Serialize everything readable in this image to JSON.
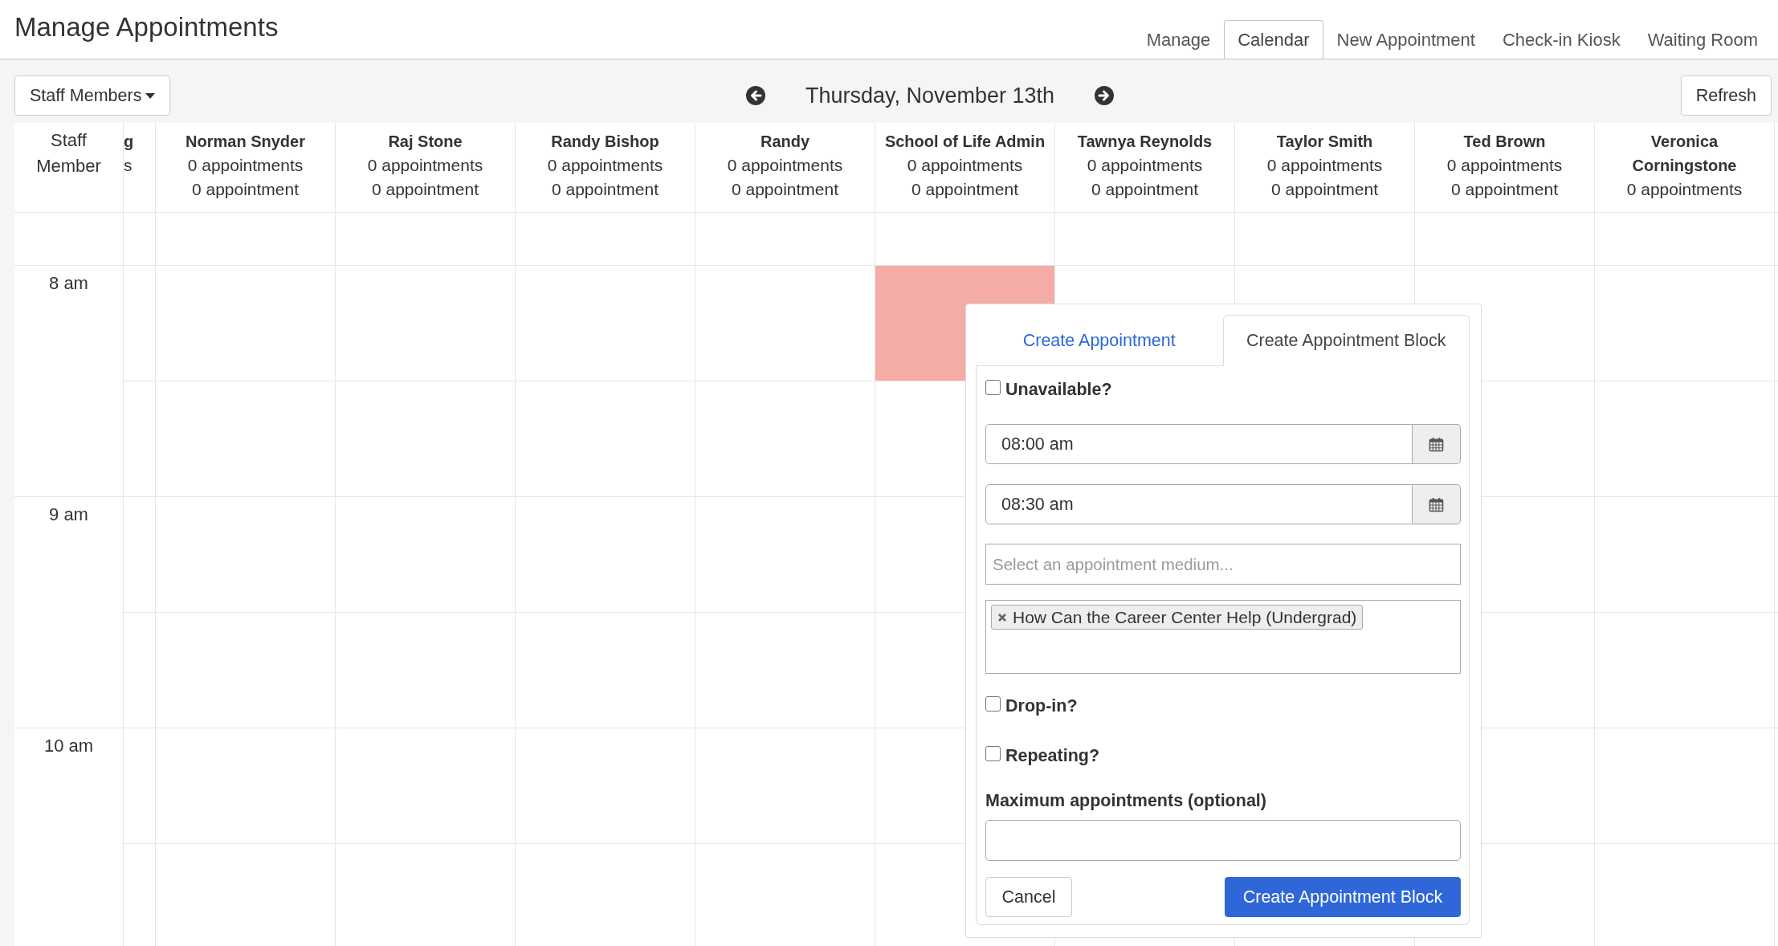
{
  "header": {
    "title": "Manage Appointments",
    "tabs": [
      {
        "label": "Manage",
        "selected": false
      },
      {
        "label": "Calendar",
        "selected": true
      },
      {
        "label": "New Appointment",
        "selected": false
      },
      {
        "label": "Check-in Kiosk",
        "selected": false
      },
      {
        "label": "Waiting Room",
        "selected": false
      }
    ]
  },
  "toolbar": {
    "staff_filter": "Staff Members",
    "date": "Thursday, November 13th",
    "refresh": "Refresh"
  },
  "calendar": {
    "corner_label": "Staff Member",
    "staff": [
      {
        "kind": "clipped",
        "name": "g",
        "lines": [
          "s"
        ],
        "selected": false
      },
      {
        "kind": "full",
        "name": "Norman Snyder",
        "lines": [
          "0 appointments",
          "0 appointment"
        ],
        "selected": false
      },
      {
        "kind": "full",
        "name": "Raj Stone",
        "lines": [
          "0 appointments",
          "0 appointment"
        ],
        "selected": false
      },
      {
        "kind": "full",
        "name": "Randy Bishop",
        "lines": [
          "0 appointments",
          "0 appointment"
        ],
        "selected": false
      },
      {
        "kind": "full",
        "name": "Randy",
        "lines": [
          "0 appointments",
          "0 appointment"
        ],
        "selected": false
      },
      {
        "kind": "full",
        "name": "School of Life Admin",
        "lines": [
          "0 appointments",
          "0 appointment"
        ],
        "selected": true
      },
      {
        "kind": "full",
        "name": "Tawnya Reynolds",
        "lines": [
          "0 appointments",
          "0 appointment"
        ],
        "selected": false
      },
      {
        "kind": "full",
        "name": "Taylor Smith",
        "lines": [
          "0 appointments",
          "0 appointment"
        ],
        "selected": false
      },
      {
        "kind": "full",
        "name": "Ted Brown",
        "lines": [
          "0 appointments",
          "0 appointment"
        ],
        "selected": false
      },
      {
        "kind": "full",
        "name": "Veronica Corningstone",
        "lines": [
          "0 appointments"
        ],
        "selected": false
      }
    ],
    "slots": [
      {
        "kind": "hour",
        "label": "8 am",
        "selected": true
      },
      {
        "kind": "half",
        "selected": false
      },
      {
        "kind": "hour",
        "label": "9 am",
        "selected": false
      },
      {
        "kind": "half",
        "selected": false
      },
      {
        "kind": "hour",
        "label": "10 am",
        "selected": false
      },
      {
        "kind": "half",
        "selected": false
      }
    ]
  },
  "dialog": {
    "tabs": [
      {
        "label": "Create Appointment",
        "selected": false
      },
      {
        "label": "Create Appointment Block",
        "selected": true
      }
    ],
    "unavailable": {
      "label": "Unavailable?",
      "checked": false
    },
    "start_time": {
      "value": "08:00 am"
    },
    "end_time": {
      "value": "08:30 am"
    },
    "medium": {
      "placeholder": "Select an appointment medium..."
    },
    "appointment_types": [
      {
        "label": "How Can the Career Center Help (Undergrad)"
      }
    ],
    "options": [
      {
        "label": "Drop-in?",
        "checked": false
      },
      {
        "label": "Repeating?",
        "checked": false
      }
    ],
    "max_appointments": {
      "label": "Maximum appointments (optional)"
    },
    "buttons": [
      {
        "label": "Cancel",
        "kind": "secondary"
      },
      {
        "label": "Create Appointment Block",
        "kind": "primary"
      }
    ]
  }
}
